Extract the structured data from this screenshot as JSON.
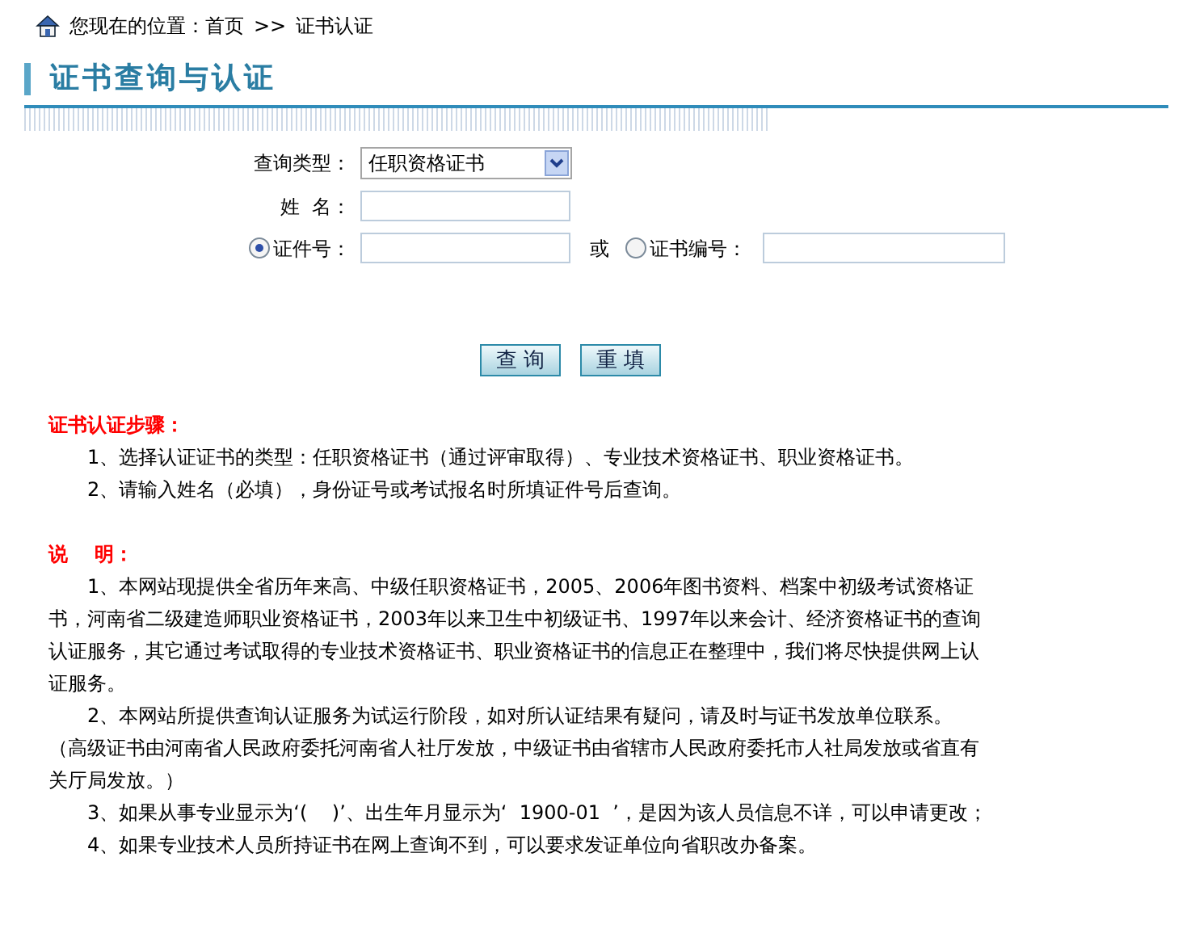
{
  "breadcrumb": {
    "prefix": "您现在的位置：",
    "home": "首页",
    "separator": ">>",
    "current": "证书认证"
  },
  "page_title": "证书查询与认证",
  "form": {
    "type_label": "查询类型：",
    "type_value": "任职资格证书",
    "name_label": "姓  名：",
    "id_options": [
      {
        "label": "证件号：",
        "selected": true
      },
      {
        "label": "证书编号：",
        "selected": false
      }
    ],
    "or_label": "或",
    "buttons": [
      "查 询",
      "重 填"
    ]
  },
  "steps": {
    "heading": "证书认证步骤：",
    "items": [
      "1、选择认证证书的类型：任职资格证书（通过评审取得）、专业技术资格证书、职业资格证书。",
      "2、请输入姓名（必填），身份证号或考试报名时所填证件号后查询。"
    ]
  },
  "notes": {
    "heading": "说    明：",
    "items": [
      {
        "kind": "indented",
        "text": "1、本网站现提供全省历年来高、中级任职资格证书，2005、2006年图书资料、档案中初级考试资格证书，河南省二级建造师职业资格证书，2003年以来卫生中初级证书、1997年以来会计、经济资格证书的查询认证服务，其它通过考试取得的专业技术资格证书、职业资格证书的信息正在整理中，我们将尽快提供网上认证服务。"
      },
      {
        "kind": "indented",
        "text": "2、本网站所提供查询认证服务为试运行阶段，如对所认证结果有疑问，请及时与证书发放单位联系。"
      },
      {
        "kind": "plain",
        "text": "（高级证书由河南省人民政府委托河南省人社厅发放，中级证书由省辖市人民政府委托市人社局发放或省直有关厅局发放。）"
      },
      {
        "kind": "indented",
        "text": "3、如果从事专业显示为‘(    )’、出生年月显示为‘  1900-01  ’，是因为该人员信息不详，可以申请更改；"
      },
      {
        "kind": "indented",
        "text": "4、如果专业技术人员所持证书在网上查询不到，可以要求发证单位向省职改办备案。"
      }
    ]
  }
}
